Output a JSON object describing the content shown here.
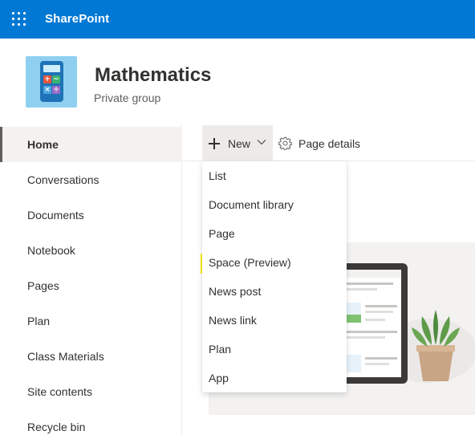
{
  "suite_bar": {
    "app_name": "SharePoint",
    "accent_color": "#0078d4",
    "launcher_icon": "waffle-icon"
  },
  "site": {
    "title": "Mathematics",
    "subtitle": "Private group",
    "logo_icon": "calculator-icon"
  },
  "left_nav": {
    "items": [
      {
        "label": "Home",
        "active": true
      },
      {
        "label": "Conversations"
      },
      {
        "label": "Documents"
      },
      {
        "label": "Notebook"
      },
      {
        "label": "Pages"
      },
      {
        "label": "Plan"
      },
      {
        "label": "Class Materials"
      },
      {
        "label": "Site contents"
      },
      {
        "label": "Recycle bin"
      }
    ]
  },
  "command_bar": {
    "new_label": "New",
    "page_details_label": "Page details"
  },
  "new_menu": {
    "items": [
      {
        "label": "List"
      },
      {
        "label": "Document library"
      },
      {
        "label": "Page"
      },
      {
        "label": "Space (Preview)",
        "highlighted": true,
        "highlight_color": "#fff200"
      },
      {
        "label": "News post"
      },
      {
        "label": "News link"
      },
      {
        "label": "Plan"
      },
      {
        "label": "App"
      }
    ]
  }
}
